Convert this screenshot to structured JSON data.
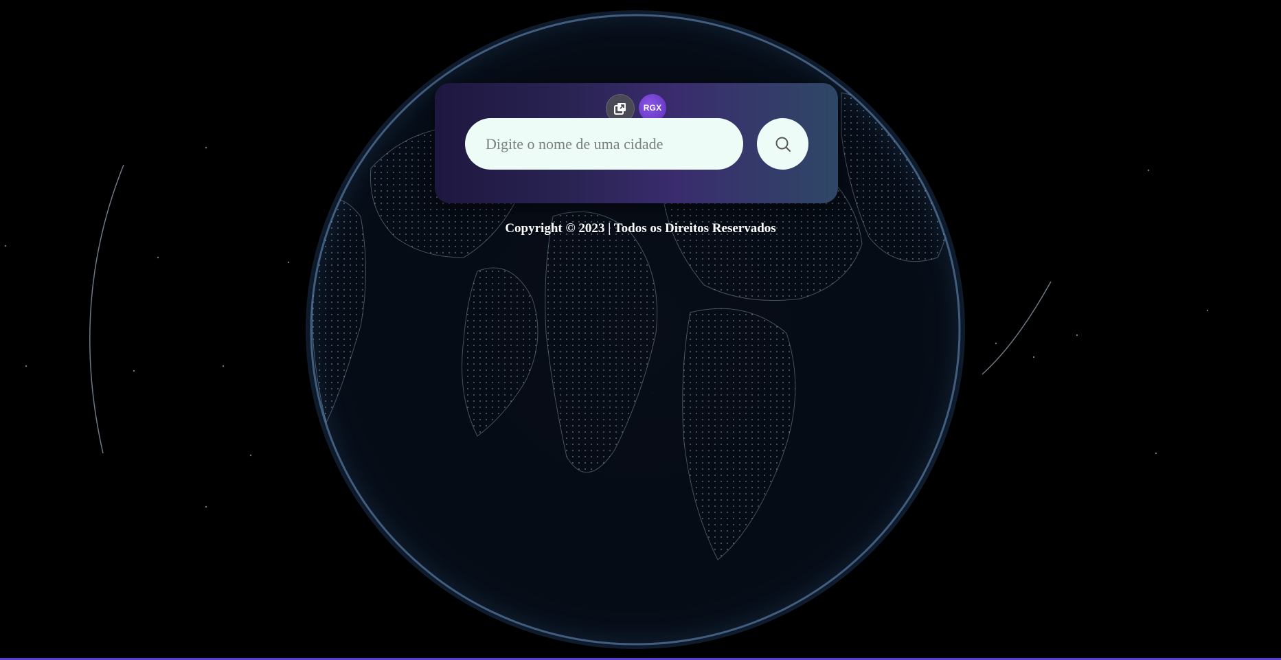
{
  "search": {
    "placeholder": "Digite o nome de uma cidade",
    "value": ""
  },
  "top_icons": {
    "copy_icon": "external-copy-icon",
    "rgx_label": "RGX"
  },
  "footer": {
    "text": "Copyright © 2023 | Todos os Direitos Reservados"
  },
  "colors": {
    "card_gradient_start": "#1e1740",
    "card_gradient_mid": "#3a2c6e",
    "card_gradient_end": "#2f4766",
    "input_bg": "#eefcf8",
    "accent_purple": "#6a3cc8",
    "bottom_bar": "#5b3fd0"
  }
}
